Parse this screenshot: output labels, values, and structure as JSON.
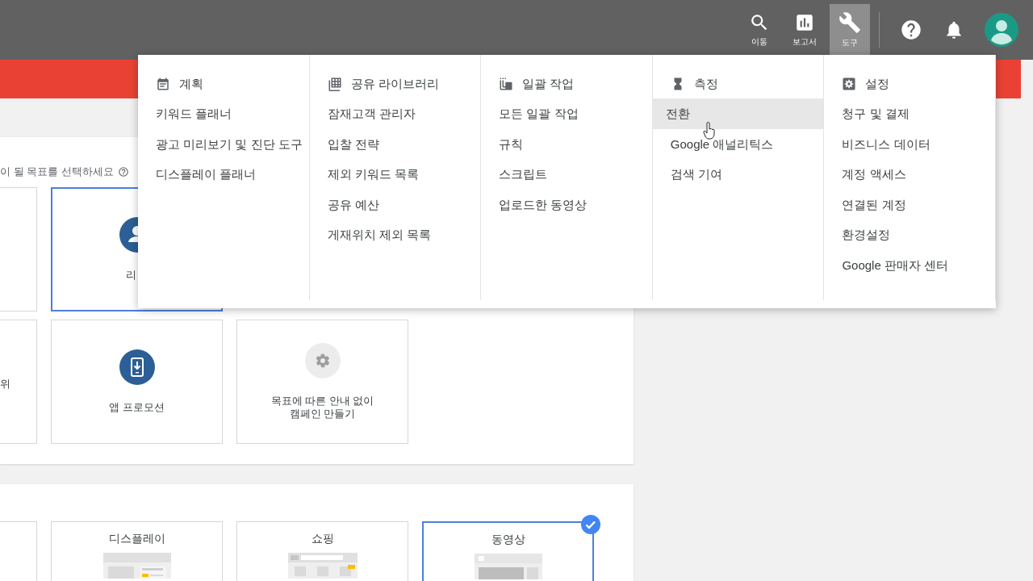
{
  "top_bar": {
    "nav_buttons": [
      {
        "kind": "search",
        "label": "이동",
        "selected": false
      },
      {
        "kind": "reports",
        "label": "보고서",
        "selected": false
      },
      {
        "kind": "tools",
        "label": "도구",
        "selected": true
      }
    ],
    "icons": [
      {
        "kind": "help"
      },
      {
        "kind": "bell"
      },
      {
        "kind": "avatar"
      }
    ]
  },
  "goal_section": {
    "prompt": "이 될 목표를 선택하세요",
    "rows": [
      [
        {
          "kind": "blank",
          "selected": false
        },
        {
          "kind": "person",
          "label": "리",
          "selected": true
        }
      ],
      [
        {
          "kind": "blank",
          "label": "위",
          "selected": false
        },
        {
          "kind": "phone",
          "label": "앱 프로모션",
          "selected": false
        },
        {
          "kind": "gear",
          "label": "목표에 따른 안내 없이\n캠페인 만들기",
          "selected": false
        }
      ]
    ]
  },
  "type_section": {
    "tiles": [
      {
        "kind": "blank",
        "selected": false
      },
      {
        "kind": "display",
        "label": "디스플레이",
        "selected": false
      },
      {
        "kind": "shopping",
        "label": "쇼핑",
        "selected": false
      },
      {
        "kind": "video",
        "label": "동영상",
        "selected": true
      }
    ]
  },
  "tools_menu": {
    "columns": [
      {
        "kind": "calendar",
        "header": "계획",
        "items": [
          {
            "label": "키워드 플래너",
            "hovered": false
          },
          {
            "label": "광고 미리보기 및 진단 도구",
            "hovered": false
          },
          {
            "label": "디스플레이 플래너",
            "hovered": false
          }
        ]
      },
      {
        "kind": "library",
        "header": "공유 라이브러리",
        "items": [
          {
            "label": "잠재고객 관리자",
            "hovered": false
          },
          {
            "label": "입찰 전략",
            "hovered": false
          },
          {
            "label": "제외 키워드 목록",
            "hovered": false
          },
          {
            "label": "공유 예산",
            "hovered": false
          },
          {
            "label": "게재위치 제외 목록",
            "hovered": false
          }
        ]
      },
      {
        "kind": "copies",
        "header": "일괄 작업",
        "items": [
          {
            "label": "모든 일괄 작업",
            "hovered": false
          },
          {
            "label": "규칙",
            "hovered": false
          },
          {
            "label": "스크립트",
            "hovered": false
          },
          {
            "label": "업로드한 동영상",
            "hovered": false
          }
        ]
      },
      {
        "kind": "hourglass",
        "header": "측정",
        "items": [
          {
            "label": "전환",
            "hovered": true
          },
          {
            "label": "Google 애널리틱스",
            "hovered": false
          },
          {
            "label": "검색 기여",
            "hovered": false
          }
        ]
      },
      {
        "kind": "gear",
        "header": "설정",
        "items": [
          {
            "label": "청구 및 결제",
            "hovered": false
          },
          {
            "label": "비즈니스 데이터",
            "hovered": false
          },
          {
            "label": "계정 액세스",
            "hovered": false
          },
          {
            "label": "연결된 계정",
            "hovered": false
          },
          {
            "label": "환경설정",
            "hovered": false
          },
          {
            "label": "Google 판매자 센터",
            "hovered": false
          }
        ]
      }
    ]
  }
}
